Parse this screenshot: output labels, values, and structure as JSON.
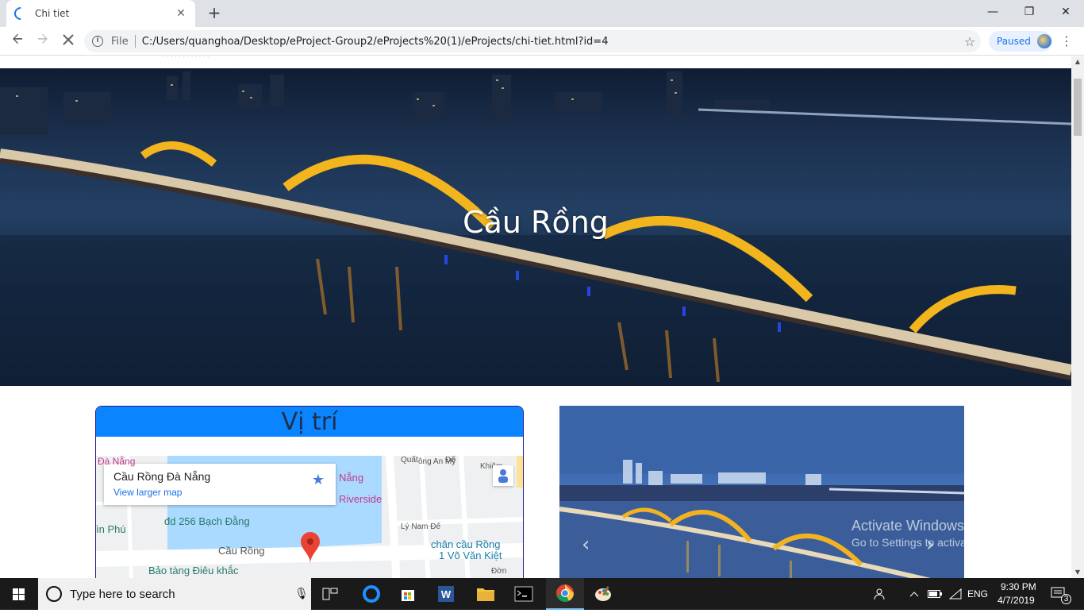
{
  "browser": {
    "tab_title": "Chi tiet",
    "tab_close": "✕",
    "new_tab": "+",
    "scheme": "File",
    "url": "C:/Users/quanghoa/Desktop/eProject-Group2/eProjects%20(1)/eProjects/chi-tiet.html?id=4",
    "profile_status": "Paused",
    "window": {
      "minimize": "—",
      "restore": "❐",
      "close": "✕"
    }
  },
  "page": {
    "hero_title": "Cầu Rồng",
    "location_card": {
      "heading": "Vị trí",
      "map": {
        "place_name": "Cầu Rồng Đà Nẵng",
        "view_larger": "View larger map",
        "labels": {
          "l1": "Đà Nẵng",
          "l2": "Nẵng",
          "l3": "Riverside",
          "l4": "đd 256 Bạch Đằng",
          "l5": "ìn Phú",
          "l6": "Cầu Rồng",
          "l7": "Bảo tàng Điêu khắc",
          "l8": "chân cầu Rồng",
          "l9": "1 Võ Văn Kiệt",
          "l10": "Lý Nam Đế",
          "l11": "Quất",
          "l12": "ông An Mỹ",
          "l13": "Đế",
          "l14": "Khiêm",
          "l15": "Đờn"
        }
      }
    }
  },
  "watermark": {
    "line1": "Activate Windows",
    "line2": "Go to Settings to activate Windows."
  },
  "taskbar": {
    "search_placeholder": "Type here to search",
    "language": "ENG",
    "time": "9:30 PM",
    "date": "4/7/2019",
    "notification_count": "3"
  },
  "colors": {
    "header_blue": "#0a84ff",
    "link_blue": "#1a73e8",
    "pin_red": "#ea4335"
  }
}
